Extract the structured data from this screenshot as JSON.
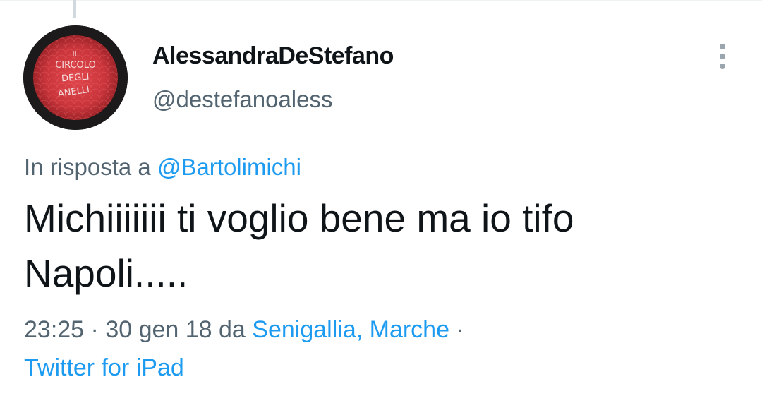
{
  "colors": {
    "link": "#1d9bf0",
    "secondary_text": "#536471",
    "primary_text": "#0f1419"
  },
  "author": {
    "display_name": "AlessandraDeStefano",
    "handle": "@destefanoaless",
    "avatar_text": [
      "IL",
      "CIRCOLO",
      "DEGLI",
      "ANELLI"
    ]
  },
  "more_icon": "vertical-ellipsis-icon",
  "reply": {
    "prefix": "In risposta a ",
    "mention": "@Bartolimichi"
  },
  "tweet": {
    "line1": "Michiiiiiii ti voglio bene ma io tifo",
    "line2": "Napoli....."
  },
  "meta": {
    "time": "23:25",
    "sep1": " · ",
    "date": "30 gen 18",
    "via": " da ",
    "location": "Senigallia, Marche",
    "sep2": " ·",
    "source": "Twitter for iPad"
  }
}
